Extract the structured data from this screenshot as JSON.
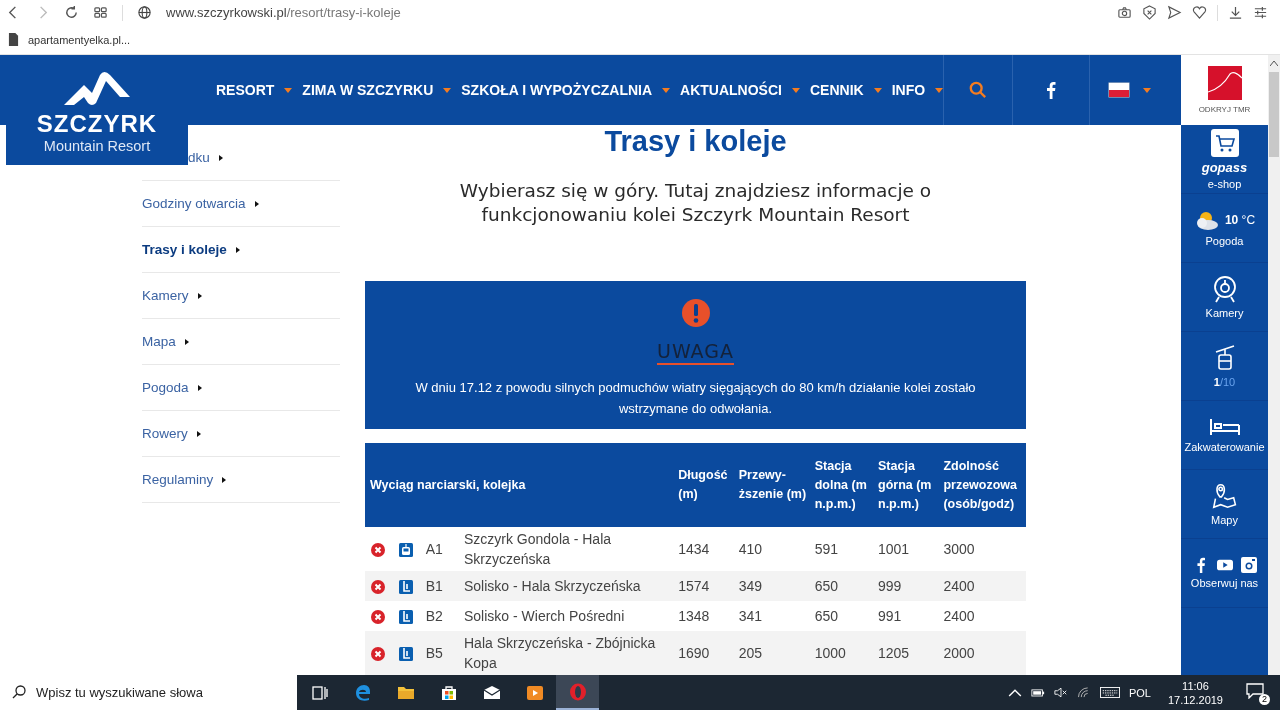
{
  "browser": {
    "url_domain": "www.szczyrkowski.pl",
    "url_path": "/resort/trasy-i-koleje",
    "bookmarks": [
      "apartamentyelka.pl..."
    ]
  },
  "header": {
    "logo_title": "SZCZYRK",
    "logo_subtitle": "Mountain Resort",
    "nav": [
      "RESORT",
      "ZIMA W SZCZYRKU",
      "SZKOŁA I WYPOŻYCZALNIA",
      "AKTUALNOŚCI",
      "CENNIK",
      "INFO"
    ]
  },
  "side_menu": [
    {
      "label": "dku",
      "selected": false
    },
    {
      "label": "Godziny otwarcia",
      "selected": false
    },
    {
      "label": "Trasy i koleje",
      "selected": true
    },
    {
      "label": "Kamery",
      "selected": false
    },
    {
      "label": "Mapa",
      "selected": false
    },
    {
      "label": "Pogoda",
      "selected": false
    },
    {
      "label": "Rowery",
      "selected": false
    },
    {
      "label": "Regulaminy",
      "selected": false
    }
  ],
  "page": {
    "title": "Trasy i koleje",
    "subtitle": "Wybierasz się w góry. Tutaj znajdziesz informacje o funkcjonowaniu kolei Szczyrk Mountain Resort"
  },
  "alert": {
    "heading": "UWAGA",
    "text": "W dniu 17.12 z powodu silnych podmuchów wiatry sięgających do 80 km/h działanie kolei zostało wstrzymane do odwołania."
  },
  "table": {
    "columns": [
      "Wyciąg narciarski, kolejka",
      "Długość (m)",
      "Przewy-ższenie (m)",
      "Stacja dolna (m n.p.m.)",
      "Stacja górna (m n.p.m.)",
      "Zdolność przewozowa (osób/godz)"
    ],
    "rows": [
      {
        "closed": true,
        "kind": "gondola",
        "code": "A1",
        "name": "Szczyrk Gondola - Hala Skrzyczeńska",
        "length": "1434",
        "elevation": "410",
        "lower": "591",
        "upper": "1001",
        "capacity": "3000"
      },
      {
        "closed": true,
        "kind": "chairlift",
        "code": "B1",
        "name": "Solisko - Hala Skrzyczeńska",
        "length": "1574",
        "elevation": "349",
        "lower": "650",
        "upper": "999",
        "capacity": "2400"
      },
      {
        "closed": true,
        "kind": "chairlift",
        "code": "B2",
        "name": "Solisko - Wierch Pośredni",
        "length": "1348",
        "elevation": "341",
        "lower": "650",
        "upper": "991",
        "capacity": "2400"
      },
      {
        "closed": true,
        "kind": "chairlift",
        "code": "B5",
        "name": "Hala Skrzyczeńska - Zbójnicka Kopa",
        "length": "1690",
        "elevation": "205",
        "lower": "1000",
        "upper": "1205",
        "capacity": "2000"
      }
    ]
  },
  "right_sidebar": {
    "top_label": "ODKRYJ TMR",
    "items": [
      {
        "kind": "shop",
        "brand": "gopass",
        "label": "e-shop"
      },
      {
        "kind": "weather",
        "temperature": "10",
        "unit": "°C",
        "label": "Pogoda"
      },
      {
        "kind": "cameras",
        "label": "Kamery"
      },
      {
        "kind": "lifts",
        "open": "1",
        "total": "/10"
      },
      {
        "kind": "lodging",
        "label": "Zakwaterowanie"
      },
      {
        "kind": "maps",
        "label": "Mapy"
      },
      {
        "kind": "social",
        "label": "Obserwuj nas"
      }
    ]
  },
  "taskbar": {
    "search_placeholder": "Wpisz tu wyszukiwane słowa",
    "apps": [
      {
        "kind": "task-view",
        "selected": false
      },
      {
        "kind": "edge",
        "selected": false
      },
      {
        "kind": "explorer",
        "selected": false
      },
      {
        "kind": "store",
        "selected": false
      },
      {
        "kind": "mail",
        "selected": false
      },
      {
        "kind": "media",
        "selected": false
      },
      {
        "kind": "opera",
        "selected": true
      }
    ],
    "language": "POL",
    "time": "11:06",
    "date": "17.12.2019",
    "notifications": "2"
  }
}
